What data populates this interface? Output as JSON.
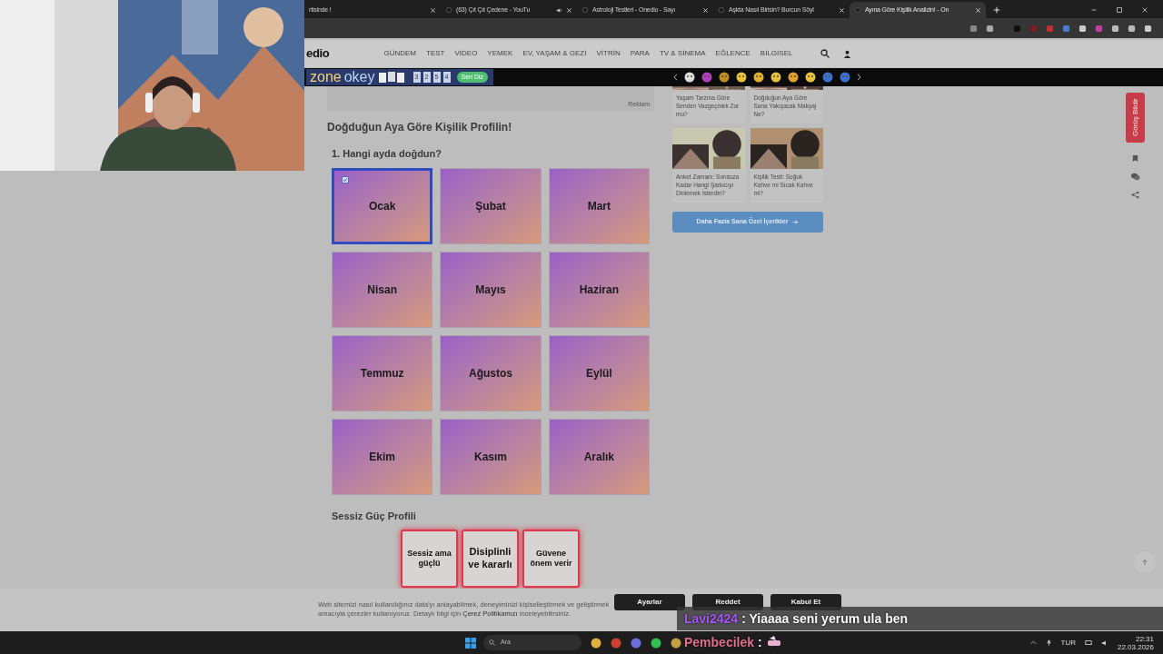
{
  "browser": {
    "tabs": [
      {
        "title": "rtisinde !",
        "selected": false,
        "audio": false
      },
      {
        "title": "(63) Çıt Çıt Çedene - YouTu",
        "selected": false,
        "audio": true
      },
      {
        "title": "Astroloji Testleri - Onedio - Sayı",
        "selected": false,
        "audio": false
      },
      {
        "title": "Aşkta Nasıl Birisin? Burcun Söyl",
        "selected": false,
        "audio": false
      },
      {
        "title": "Ayına Göre Kişilik Analizin! - On",
        "selected": true,
        "audio": false
      }
    ]
  },
  "site": {
    "logo": "edio",
    "nav": [
      "GÜNDEM",
      "TEST",
      "VİDEO",
      "YEMEK",
      "EV, YAŞAM & GEZİ",
      "VİTRİN",
      "PARA",
      "TV & SİNEMA",
      "EĞLENCE",
      "BİLGİSEL"
    ]
  },
  "ad_strip": {
    "brand_a": "zone",
    "brand_b": "okey",
    "tiles": [
      "3",
      "2",
      "5",
      "4"
    ],
    "button": "Seri Diz"
  },
  "ad_label": "Reklam",
  "quiz": {
    "title": "Doğduğun Aya Göre Kişilik Profilin!",
    "question": "1. Hangi ayda doğdun?",
    "options": [
      {
        "label": "Ocak",
        "selected": true
      },
      {
        "label": "Şubat",
        "selected": false
      },
      {
        "label": "Mart",
        "selected": false
      },
      {
        "label": "Nisan",
        "selected": false
      },
      {
        "label": "Mayıs",
        "selected": false
      },
      {
        "label": "Haziran",
        "selected": false
      },
      {
        "label": "Temmuz",
        "selected": false
      },
      {
        "label": "Ağustos",
        "selected": false
      },
      {
        "label": "Eylül",
        "selected": false
      },
      {
        "label": "Ekim",
        "selected": false
      },
      {
        "label": "Kasım",
        "selected": false
      },
      {
        "label": "Aralık",
        "selected": false
      }
    ]
  },
  "profile": {
    "title": "Sessiz Güç Profili",
    "traits": [
      "Sessiz ama güçlü",
      "Disiplinli ve kararlı",
      "Güvene önem verir"
    ]
  },
  "sidebar": {
    "cards": [
      {
        "caption": "Yaşam Tarzına Göre Senden Vazgeçmek Zor mu?",
        "image_cut": true
      },
      {
        "caption": "Doğduğun Aya Göre Sana Yakışacak Makyaj Ne?",
        "image_cut": true
      },
      {
        "caption": "Anket Zamanı: Sonsuza Kadar Hangi Şarkıcıyı Dinlemek İsterdin?",
        "image_cut": false
      },
      {
        "caption": "Kişilik Testi: Soğuk Kahve mi Sıcak Kahve mi?",
        "image_cut": false
      }
    ],
    "more_button": "Daha Fazla Sana Özel İçerikler"
  },
  "feedback_button": "Görüş Bildir",
  "cookie": {
    "text_before": "Web sitemizi nasıl kullandığınız data'yı anlayabilmek, deneyiminizi kişiselleştirmek ve geliştirmek amacıyla çerezler kullanıyoruz. Detaylı bilgi için ",
    "link": "Çerez Politikamızı",
    "text_after": " inceleyebilirsiniz.",
    "buttons": [
      "Ayarlar",
      "Reddet",
      "Kabul Et"
    ]
  },
  "taskbar": {
    "search_placeholder": "Ara",
    "language": "TUR",
    "time": "22:31",
    "date": "22.03.2026"
  },
  "chat": [
    {
      "user": "Lavi2424",
      "color": "#a855f7",
      "message": ": Yiaaaa seni yerum ula ben"
    },
    {
      "user": "Pembecilek",
      "color": "#e0708e",
      "message": ":"
    }
  ]
}
